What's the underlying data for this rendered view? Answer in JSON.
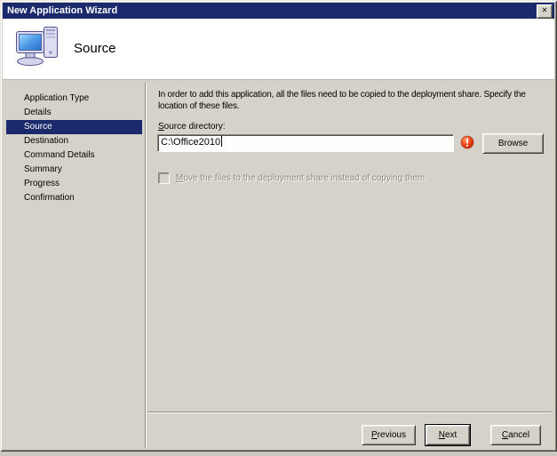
{
  "window": {
    "title": "New Application Wizard",
    "close_glyph": "✕"
  },
  "header": {
    "title": "Source",
    "icon": "computer-icon"
  },
  "sidebar": {
    "items": [
      "Application Type",
      "Details",
      "Source",
      "Destination",
      "Command Details",
      "Summary",
      "Progress",
      "Confirmation"
    ],
    "selected_index": 2,
    "selected_item": "Source"
  },
  "main": {
    "instruction": "In order to add this application, all the files need to be copied to the deployment share.  Specify the location of these files.",
    "source_directory": {
      "label_accel": "S",
      "label_rest": "ource directory:",
      "value": "C:\\Office2010",
      "validation": "error",
      "error_icon": "validation-error-icon",
      "browse_label": "Browse"
    },
    "move_checkbox": {
      "label_accel": "M",
      "label_rest": "ove the files to the deployment share instead of copying them",
      "checked": false,
      "enabled": false
    }
  },
  "footer": {
    "previous_button": {
      "accel": "P",
      "rest": "revious",
      "is_default": false
    },
    "next_button": {
      "accel": "N",
      "rest": "ext",
      "is_default": true
    },
    "cancel_button": {
      "accel": "C",
      "rest": "ancel",
      "is_default": false
    }
  },
  "colors": {
    "titlebar": "#1a2a6c",
    "selection": "#1a2a6c",
    "dialog_face": "#d5d2ca",
    "header_background": "#ffffff",
    "error_red": "#e03a14",
    "disabled_text": "#8b8880"
  }
}
